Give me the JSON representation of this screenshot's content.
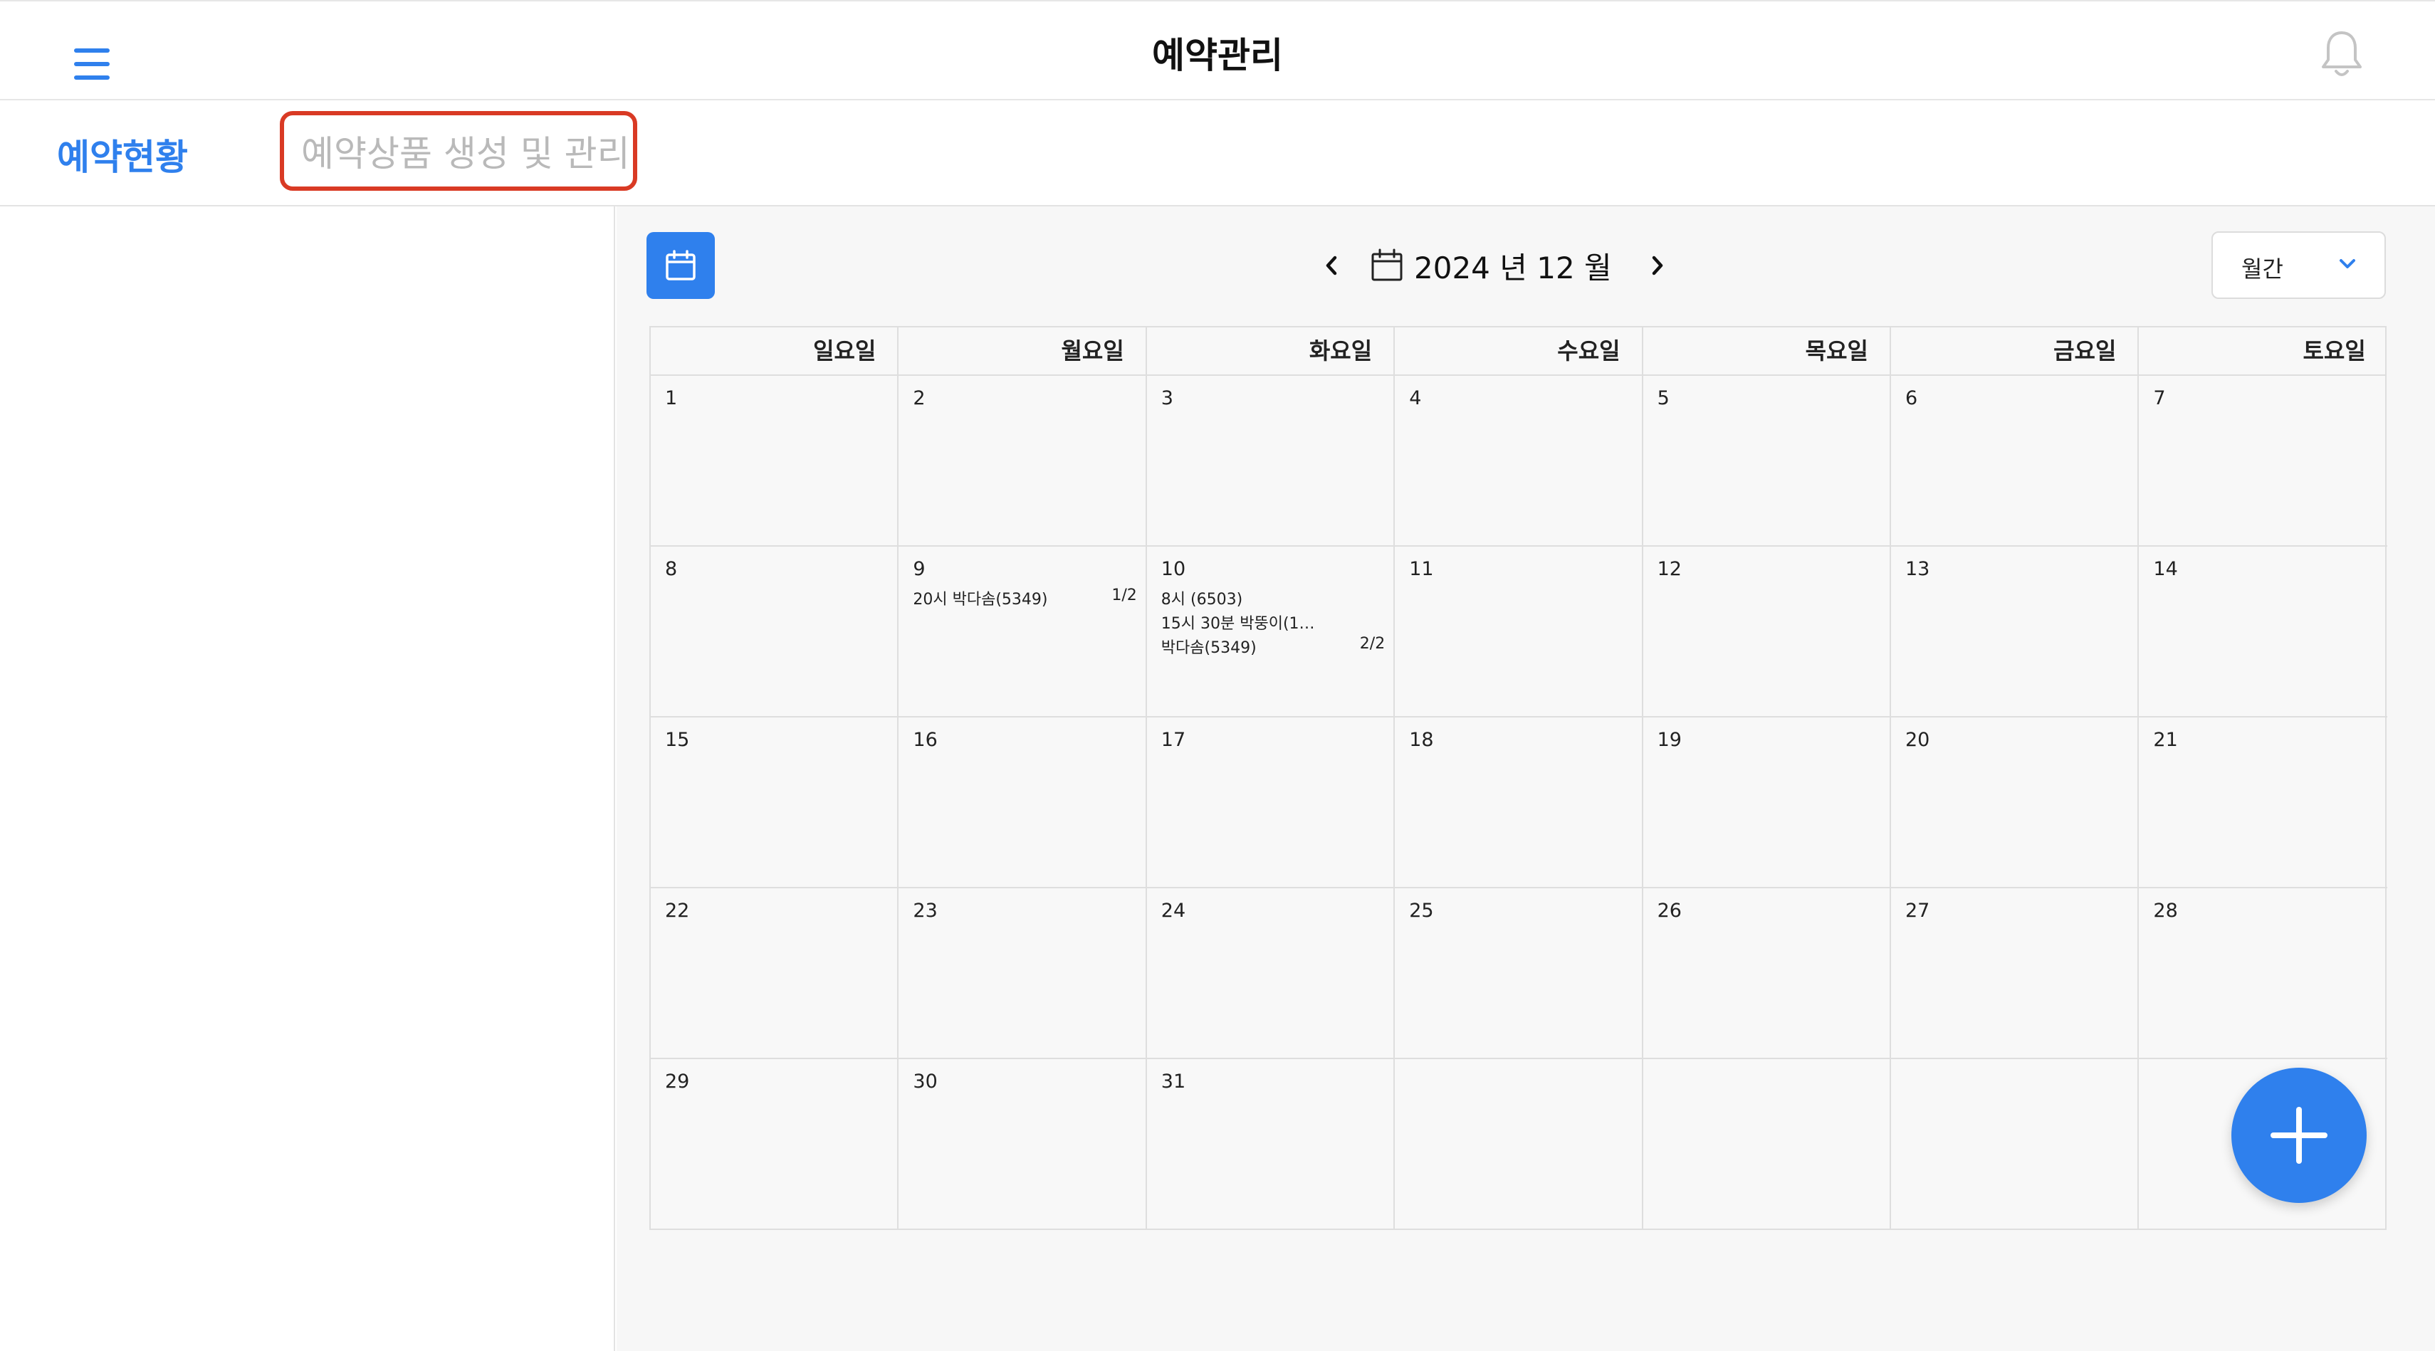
{
  "header": {
    "title": "예약관리",
    "menu_icon": "hamburger-menu-icon",
    "bell_icon": "bell-icon"
  },
  "tabs": [
    {
      "label": "예약현황",
      "active": true
    },
    {
      "label": "예약상품 생성 및 관리",
      "active": false
    }
  ],
  "toolbar": {
    "calendar_button_icon": "calendar-icon",
    "prev_icon": "chevron-left-icon",
    "next_icon": "chevron-right-icon",
    "month_label": "2024 년  12 월",
    "view_select": {
      "value": "월간",
      "icon": "chevron-down-icon"
    }
  },
  "calendar": {
    "weekdays": [
      "일요일",
      "월요일",
      "화요일",
      "수요일",
      "목요일",
      "금요일",
      "토요일"
    ],
    "weeks": [
      [
        {
          "day": "1"
        },
        {
          "day": "2"
        },
        {
          "day": "3"
        },
        {
          "day": "4"
        },
        {
          "day": "5"
        },
        {
          "day": "6"
        },
        {
          "day": "7"
        }
      ],
      [
        {
          "day": "8"
        },
        {
          "day": "9",
          "events": [
            {
              "text": "20시 박다솜(5349)",
              "count": "1/2"
            }
          ]
        },
        {
          "day": "10",
          "events": [
            {
              "text": "8시 (6503)"
            },
            {
              "text": "15시 30분 박뚱이(1…"
            },
            {
              "text": "박다솜(5349)",
              "count": "2/2"
            }
          ]
        },
        {
          "day": "11"
        },
        {
          "day": "12"
        },
        {
          "day": "13"
        },
        {
          "day": "14"
        }
      ],
      [
        {
          "day": "15"
        },
        {
          "day": "16"
        },
        {
          "day": "17"
        },
        {
          "day": "18"
        },
        {
          "day": "19"
        },
        {
          "day": "20"
        },
        {
          "day": "21"
        }
      ],
      [
        {
          "day": "22"
        },
        {
          "day": "23"
        },
        {
          "day": "24"
        },
        {
          "day": "25"
        },
        {
          "day": "26"
        },
        {
          "day": "27"
        },
        {
          "day": "28"
        }
      ],
      [
        {
          "day": "29"
        },
        {
          "day": "30"
        },
        {
          "day": "31"
        },
        {
          "day": ""
        },
        {
          "day": ""
        },
        {
          "day": ""
        },
        {
          "day": ""
        }
      ]
    ]
  },
  "fab": {
    "icon": "plus-icon",
    "color": "#2f80ed"
  },
  "colors": {
    "accent": "#2f80ed",
    "highlight_border": "#d93a24"
  }
}
